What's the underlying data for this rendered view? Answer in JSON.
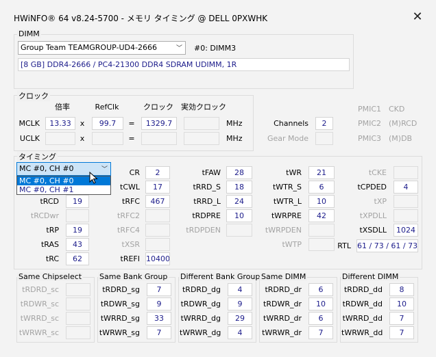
{
  "window": {
    "title": "HWiNFO® 64 v8.24-5700 - メモリ タイミング @ DELL 0PXWHK",
    "close_glyph": "✕"
  },
  "dimm": {
    "legend": "DIMM",
    "selected_module": "Group Team TEAMGROUP-UD4-2666",
    "slot_label": "#0: DIMM3",
    "description": "[8 GB] DDR4-2666 / PC4-21300 DDR4 SDRAM UDIMM, 1R"
  },
  "clock": {
    "legend": "クロック",
    "headers": {
      "ratio": "倍率",
      "refclk": "RefClk",
      "clock": "クロック",
      "effective": "実効クロック"
    },
    "mclk": {
      "label": "MCLK",
      "ratio": "13.33",
      "x": "x",
      "refclk": "99.7",
      "eq": "=",
      "clock": "1329.7",
      "effective": "",
      "unit": "MHz"
    },
    "uclk": {
      "label": "UCLK",
      "ratio": "",
      "x": "x",
      "refclk": "",
      "eq": "=",
      "clock": "",
      "effective": "",
      "unit": "MHz"
    },
    "channels_label": "Channels",
    "channels_value": "2",
    "gear_mode_label": "Gear Mode",
    "gear_mode_value": "",
    "pmic": [
      {
        "name": "PMIC1",
        "value": "CKD"
      },
      {
        "name": "PMIC2",
        "value": "(M)RCD"
      },
      {
        "name": "PMIC3",
        "value": "(M)DB"
      }
    ]
  },
  "timing": {
    "legend": "タイミング",
    "selected_channel": "MC #0, CH #0",
    "channel_options": [
      "MC #0, CH #0",
      "MC #0, CH #1"
    ],
    "col1": [
      {
        "label": "tRCD",
        "value": "19",
        "enabled": true
      },
      {
        "label": "tRCDwr",
        "value": "",
        "enabled": false
      },
      {
        "label": "tRP",
        "value": "19",
        "enabled": true
      },
      {
        "label": "tRAS",
        "value": "43",
        "enabled": true
      },
      {
        "label": "tRC",
        "value": "62",
        "enabled": true
      }
    ],
    "col2": [
      {
        "label": "CR",
        "value": "2",
        "enabled": true
      },
      {
        "label": "tCWL",
        "value": "17",
        "enabled": true
      },
      {
        "label": "tRFC",
        "value": "467",
        "enabled": true
      },
      {
        "label": "tRFC2",
        "value": "",
        "enabled": false
      },
      {
        "label": "tRFC4",
        "value": "",
        "enabled": false
      },
      {
        "label": "tXSR",
        "value": "",
        "enabled": false
      },
      {
        "label": "tREFI",
        "value": "10400",
        "enabled": true
      }
    ],
    "col3": [
      {
        "label": "tFAW",
        "value": "28",
        "enabled": true
      },
      {
        "label": "tRRD_S",
        "value": "18",
        "enabled": true
      },
      {
        "label": "tRRD_L",
        "value": "24",
        "enabled": true
      },
      {
        "label": "tRDPRE",
        "value": "10",
        "enabled": true
      },
      {
        "label": "tRDPDEN",
        "value": "",
        "enabled": false
      }
    ],
    "col4": [
      {
        "label": "tWR",
        "value": "21",
        "enabled": true
      },
      {
        "label": "tWTR_S",
        "value": "6",
        "enabled": true
      },
      {
        "label": "tWTR_L",
        "value": "10",
        "enabled": true
      },
      {
        "label": "tWRPRE",
        "value": "42",
        "enabled": true
      },
      {
        "label": "tWRPDEN",
        "value": "",
        "enabled": false
      },
      {
        "label": "tWTP",
        "value": "",
        "enabled": false
      }
    ],
    "col5": [
      {
        "label": "tCKE",
        "value": "",
        "enabled": false
      },
      {
        "label": "tCPDED",
        "value": "4",
        "enabled": true
      },
      {
        "label": "tXP",
        "value": "",
        "enabled": false
      },
      {
        "label": "tXPDLL",
        "value": "",
        "enabled": false
      },
      {
        "label": "tXSDLL",
        "value": "1024",
        "enabled": true
      }
    ],
    "rtl_label": "RTL",
    "rtl_value": "61 / 73 / 61 / 73"
  },
  "bottom": [
    {
      "legend": "Same Chipselect",
      "rows": [
        {
          "label": "tRDRD_sc",
          "value": "",
          "enabled": false
        },
        {
          "label": "tRDWR_sc",
          "value": "",
          "enabled": false
        },
        {
          "label": "tWRRD_sc",
          "value": "",
          "enabled": false
        },
        {
          "label": "tWRWR_sc",
          "value": "",
          "enabled": false
        }
      ]
    },
    {
      "legend": "Same Bank Group",
      "rows": [
        {
          "label": "tRDRD_sg",
          "value": "7",
          "enabled": true
        },
        {
          "label": "tRDWR_sg",
          "value": "9",
          "enabled": true
        },
        {
          "label": "tWRRD_sg",
          "value": "33",
          "enabled": true
        },
        {
          "label": "tWRWR_sg",
          "value": "7",
          "enabled": true
        }
      ]
    },
    {
      "legend": "Different Bank Group",
      "rows": [
        {
          "label": "tRDRD_dg",
          "value": "4",
          "enabled": true
        },
        {
          "label": "tRDWR_dg",
          "value": "9",
          "enabled": true
        },
        {
          "label": "tWRRD_dg",
          "value": "29",
          "enabled": true
        },
        {
          "label": "tWRWR_dg",
          "value": "4",
          "enabled": true
        }
      ]
    },
    {
      "legend": "Same DIMM",
      "rows": [
        {
          "label": "tRDRD_dr",
          "value": "6",
          "enabled": true
        },
        {
          "label": "tRDWR_dr",
          "value": "10",
          "enabled": true
        },
        {
          "label": "tWRRD_dr",
          "value": "6",
          "enabled": true
        },
        {
          "label": "tWRWR_dr",
          "value": "7",
          "enabled": true
        }
      ]
    },
    {
      "legend": "Different DIMM",
      "rows": [
        {
          "label": "tRDRD_dd",
          "value": "8",
          "enabled": true
        },
        {
          "label": "tRDWR_dd",
          "value": "10",
          "enabled": true
        },
        {
          "label": "tWRRD_dd",
          "value": "7",
          "enabled": true
        },
        {
          "label": "tWRWR_dd",
          "value": "7",
          "enabled": true
        }
      ]
    }
  ]
}
